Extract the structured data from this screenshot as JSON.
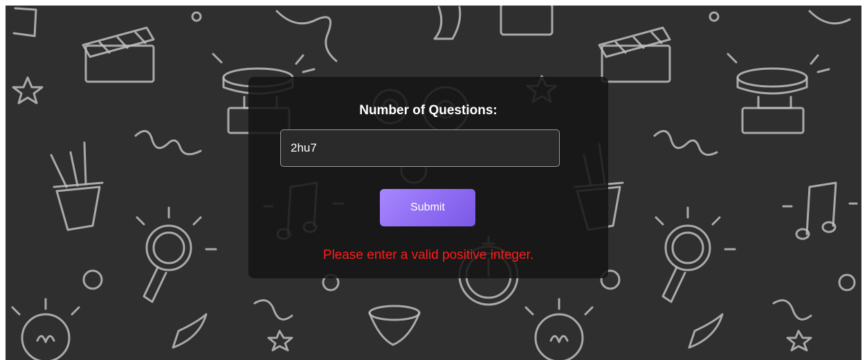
{
  "form": {
    "label": "Number of Questions:",
    "input_value": "2hu7",
    "submit_label": "Submit",
    "error_message": "Please enter a valid positive integer."
  },
  "colors": {
    "page_background": "#2f2f2f",
    "panel_background": "#161616",
    "accent": "#8e6cf2",
    "error": "#ff1b1b"
  },
  "decorations": {
    "doodle_icons": [
      "clapperboard-icon",
      "star-icon",
      "buzzer-icon",
      "pencil-cup-icon",
      "magnifier-icon",
      "music-note-icon",
      "light-bulb-icon",
      "gear-icon",
      "stopwatch-icon",
      "confetti-icon",
      "hourglass-icon",
      "ribbon-icon"
    ]
  }
}
